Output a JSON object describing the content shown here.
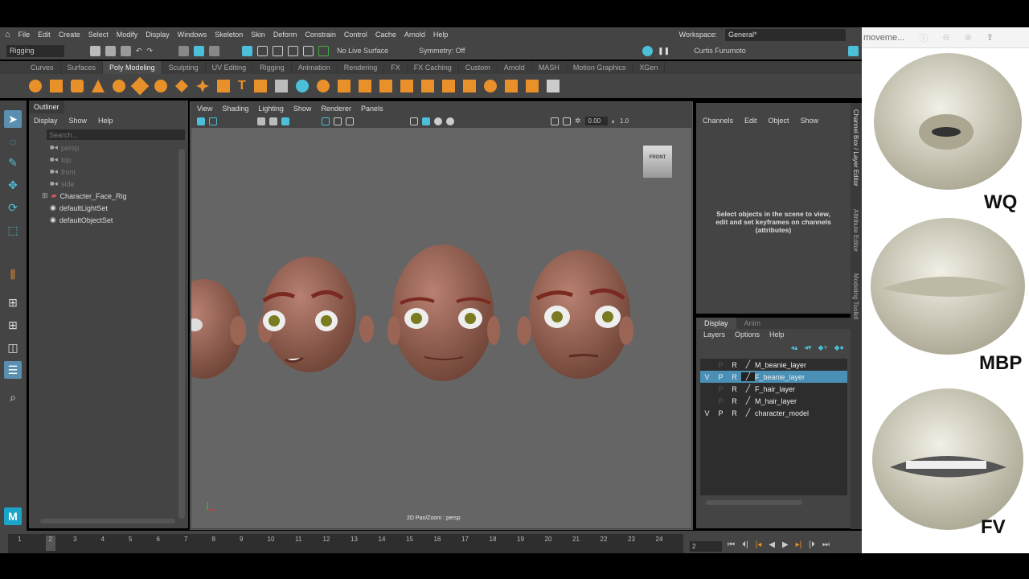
{
  "menubar": {
    "items": [
      "File",
      "Edit",
      "Create",
      "Select",
      "Modify",
      "Display",
      "Windows",
      "Skeleton",
      "Skin",
      "Deform",
      "Constrain",
      "Control",
      "Cache",
      "Arnold",
      "Help"
    ],
    "workspace_label": "Workspace:",
    "workspace_value": "General*"
  },
  "status": {
    "mode": "Rigging",
    "live_surface": "No Live Surface",
    "symmetry": "Symmetry: Off",
    "user": "Curtis Furumoto"
  },
  "shelf_tabs": [
    "Curves",
    "Surfaces",
    "Poly Modeling",
    "Sculpting",
    "UV Editing",
    "Rigging",
    "Animation",
    "Rendering",
    "FX",
    "FX Caching",
    "Custom",
    "Arnold",
    "MASH",
    "Motion Graphics",
    "XGen"
  ],
  "outliner": {
    "title": "Outliner",
    "menu": [
      "Display",
      "Show",
      "Help"
    ],
    "search_placeholder": "Search...",
    "items": [
      "persp",
      "top",
      "front",
      "side",
      "Character_Face_Rig",
      "defaultLightSet",
      "defaultObjectSet"
    ]
  },
  "viewport": {
    "menu": [
      "View",
      "Shading",
      "Lighting",
      "Show",
      "Renderer",
      "Panels"
    ],
    "field1": "0.00",
    "field2": "1.0",
    "view_cube": "FRONT",
    "hud": "2D Pan/Zoom : persp"
  },
  "channel_box": {
    "menu": [
      "Channels",
      "Edit",
      "Object",
      "Show"
    ],
    "message": "Select objects in the scene to view, edit and set keyframes on channels (attributes)"
  },
  "layers": {
    "tabs": [
      "Display",
      "Anim"
    ],
    "menu": [
      "Layers",
      "Options",
      "Help"
    ],
    "rows": [
      {
        "v": "",
        "p": "P",
        "r": "R",
        "name": "M_beanie_layer"
      },
      {
        "v": "V",
        "p": "P",
        "r": "R",
        "name": "F_beanie_layer"
      },
      {
        "v": "",
        "p": "P",
        "r": "R",
        "name": "F_hair_layer"
      },
      {
        "v": "",
        "p": "P",
        "r": "R",
        "name": "M_hair_layer"
      },
      {
        "v": "V",
        "p": "P",
        "r": "R",
        "name": "character_model"
      }
    ]
  },
  "side_tabs": [
    "Channel Box / Layer Editor",
    "Attribute Editor",
    "Modeling Toolkit"
  ],
  "timeline": {
    "ticks": [
      "1",
      "2",
      "3",
      "4",
      "5",
      "6",
      "7",
      "8",
      "9",
      "10",
      "11",
      "12",
      "13",
      "14",
      "15",
      "16",
      "17",
      "18",
      "19",
      "20",
      "21",
      "22",
      "23",
      "24"
    ],
    "current": "2",
    "current_frame_field": "2"
  },
  "browser": {
    "title": "moveme...",
    "labels": [
      "WQ",
      "MBP",
      "FV"
    ]
  },
  "colors": {
    "accent": "#4bc0d8",
    "selection": "#4a8fb6",
    "shelf_icon": "#e8902a"
  }
}
